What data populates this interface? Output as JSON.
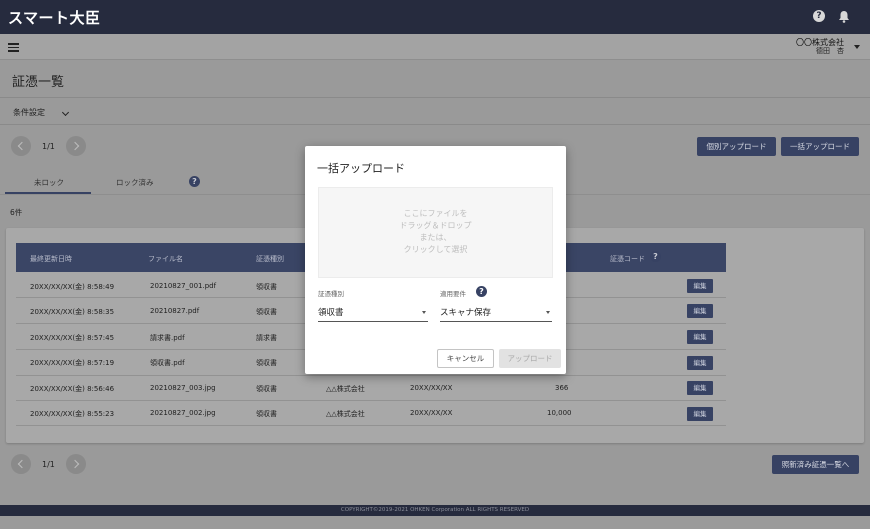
{
  "header": {
    "logo": "スマート大臣",
    "help_icon": "?",
    "company_name": "〇〇株式会社",
    "user": "德田　杏"
  },
  "page": {
    "title": "証憑一覧",
    "filter_label": "条件設定"
  },
  "pager": {
    "text": "1/1"
  },
  "toolbar": {
    "individual_upload": "個別アップロード",
    "bulk_upload": "一括アップロード",
    "proceed": "照新済み証憑一覧へ"
  },
  "tabs": [
    {
      "label": "未ロック"
    },
    {
      "label": "ロック済み"
    }
  ],
  "help_icon": "?",
  "count": "6件",
  "table": {
    "headers": [
      "最終更新日時",
      "ファイル名",
      "証憑種別",
      "証憑コード"
    ],
    "rows": [
      {
        "date": "20XX/XX/XX(金) 8:58:49",
        "file": "20210827_001.pdf",
        "kind": "領収書",
        "partner": "",
        "tdate": "",
        "amount": ""
      },
      {
        "date": "20XX/XX/XX(金) 8:58:35",
        "file": "20210827.pdf",
        "kind": "領収書",
        "partner": "",
        "tdate": "",
        "amount": ""
      },
      {
        "date": "20XX/XX/XX(金) 8:57:45",
        "file": "請求書.pdf",
        "kind": "請求書",
        "partner": "",
        "tdate": "",
        "amount": ""
      },
      {
        "date": "20XX/XX/XX(金) 8:57:19",
        "file": "領収書.pdf",
        "kind": "領収書",
        "partner": "",
        "tdate": "",
        "amount": ""
      },
      {
        "date": "20XX/XX/XX(金) 8:56:46",
        "file": "20210827_003.jpg",
        "kind": "領収書",
        "partner": "△△株式会社",
        "tdate": "20XX/XX/XX",
        "amount": "366"
      },
      {
        "date": "20XX/XX/XX(金) 8:55:23",
        "file": "20210827_002.jpg",
        "kind": "領収書",
        "partner": "△△株式会社",
        "tdate": "20XX/XX/XX",
        "amount": "10,000"
      }
    ],
    "edit_label": "編集"
  },
  "footer": {
    "copyright": "COPYRIGHT©2019-2021 OHKEN Corporation ALL RIGHTS RESERVED"
  },
  "modal": {
    "title": "一括アップロード",
    "dropzone_lines": [
      "ここにファイルを",
      "ドラッグ＆ドロップ",
      "または、",
      "クリックして選択"
    ],
    "doc_type_label": "証憑種別",
    "doc_type_value": "領収書",
    "requirement_label": "適用要件",
    "requirement_value": "スキャナ保存",
    "help_icon": "?",
    "cancel": "キャンセル",
    "upload": "アップロード"
  }
}
